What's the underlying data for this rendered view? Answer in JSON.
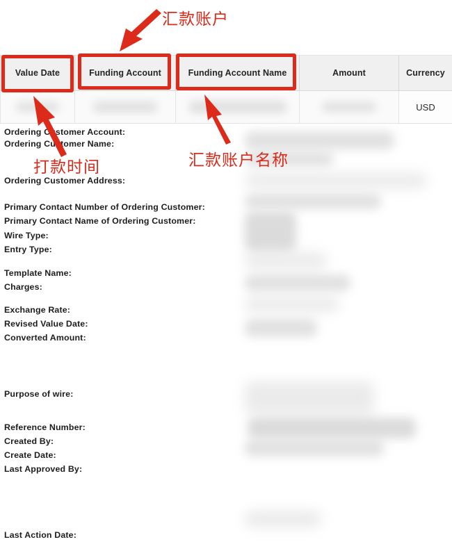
{
  "table": {
    "columns": [
      {
        "key": "value_date",
        "label": "Value Date"
      },
      {
        "key": "funding_account",
        "label": "Funding Account"
      },
      {
        "key": "funding_account_name",
        "label": "Funding Account Name"
      },
      {
        "key": "amount",
        "label": "Amount"
      },
      {
        "key": "currency",
        "label": "Currency"
      }
    ],
    "rows": [
      {
        "value_date": "",
        "funding_account": "",
        "funding_account_name": "",
        "amount": "",
        "currency": "USD"
      }
    ]
  },
  "detail": {
    "fields": [
      {
        "label": "Ordering Customer Account:",
        "value": ""
      },
      {
        "label": "Ordering Customer Name:",
        "value": ""
      },
      {
        "label": "Ordering Customer Address:",
        "value": ""
      },
      {
        "label": "Primary Contact Number of Ordering Customer:",
        "value": ""
      },
      {
        "label": "Primary Contact Name of Ordering Customer:",
        "value": ""
      },
      {
        "label": "Wire Type:",
        "value": ""
      },
      {
        "label": "Entry Type:",
        "value": ""
      },
      {
        "label": "Template Name:",
        "value": ""
      },
      {
        "label": "Charges:",
        "value": ""
      },
      {
        "label": "Exchange Rate:",
        "value": ""
      },
      {
        "label": "Revised Value Date:",
        "value": ""
      },
      {
        "label": "Converted Amount:",
        "value": ""
      },
      {
        "label": "Purpose of wire:",
        "value": ""
      },
      {
        "label": "Reference Number:",
        "value": ""
      },
      {
        "label": "Created By:",
        "value": ""
      },
      {
        "label": "Create Date:",
        "value": ""
      },
      {
        "label": "Last Approved By:",
        "value": ""
      },
      {
        "label": "Last Action Date:",
        "value": ""
      }
    ]
  },
  "annotations": {
    "accent_color": "#dc2a1b",
    "callouts": [
      {
        "text": "汇款账户",
        "target": "Funding Account"
      },
      {
        "text": "打款时间",
        "target": "Value Date"
      },
      {
        "text": "汇款账户名称",
        "target": "Funding Account Name"
      }
    ]
  }
}
